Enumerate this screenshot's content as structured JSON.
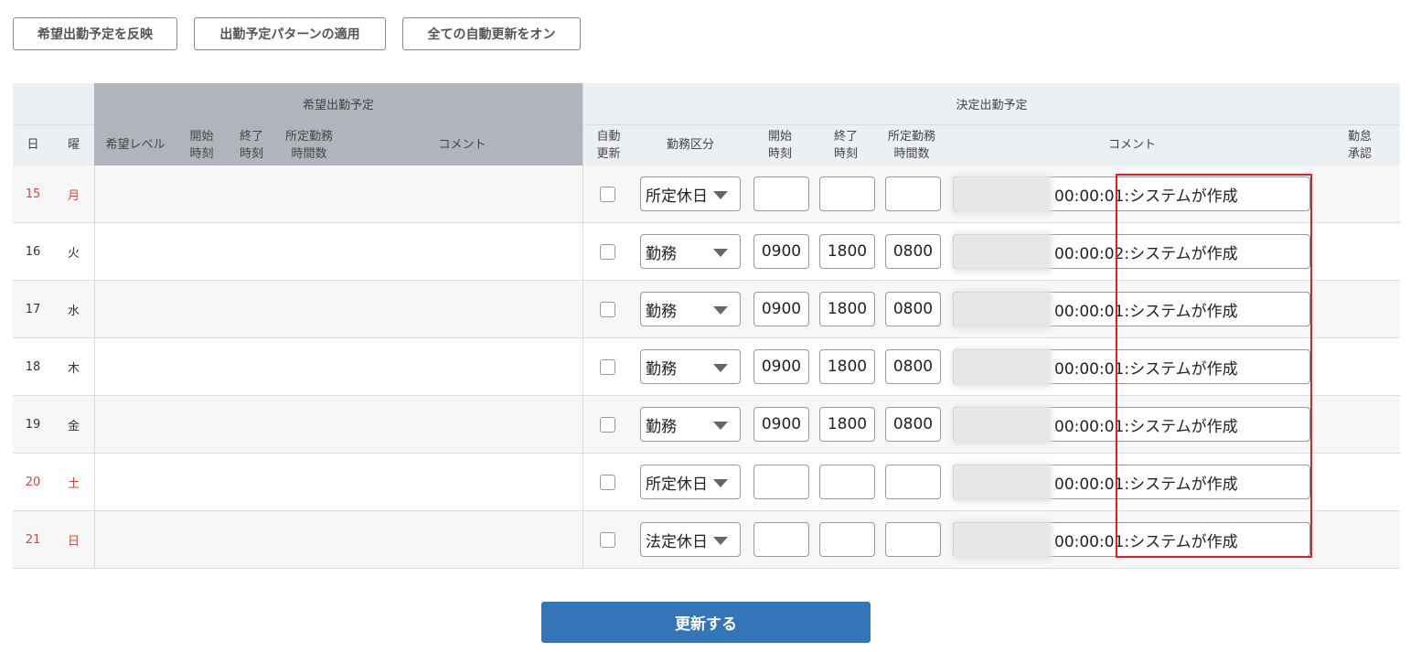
{
  "toolbar": {
    "reflect_label": "希望出勤予定を反映",
    "apply_pattern_label": "出勤予定パターンの適用",
    "auto_update_all_label": "全ての自動更新をオン"
  },
  "table": {
    "group_requested": "希望出勤予定",
    "group_decided": "決定出勤予定",
    "col_day": "日",
    "col_weekday": "曜",
    "col_req_level": "希望レベル",
    "col_req_start": "開始\n時刻",
    "col_req_end": "終了\n時刻",
    "col_req_hours": "所定勤務\n時間数",
    "col_req_comment": "コメント",
    "col_auto": "自動\n更新",
    "col_type": "勤務区分",
    "col_start": "開始\n時刻",
    "col_end": "終了\n時刻",
    "col_hours": "所定勤務\n時間数",
    "col_comment": "コメント",
    "col_approval": "勤怠\n承認"
  },
  "rows": [
    {
      "day": "15",
      "weekday": "月",
      "type": "所定休日",
      "start": "",
      "end": "",
      "hours": "",
      "comment": "00:00:01:システムが作成",
      "holiday": true
    },
    {
      "day": "16",
      "weekday": "火",
      "type": "勤務",
      "start": "0900",
      "end": "1800",
      "hours": "0800",
      "comment": "00:00:02:システムが作成",
      "holiday": false
    },
    {
      "day": "17",
      "weekday": "水",
      "type": "勤務",
      "start": "0900",
      "end": "1800",
      "hours": "0800",
      "comment": "00:00:01:システムが作成",
      "holiday": false
    },
    {
      "day": "18",
      "weekday": "木",
      "type": "勤務",
      "start": "0900",
      "end": "1800",
      "hours": "0800",
      "comment": "00:00:01:システムが作成",
      "holiday": false
    },
    {
      "day": "19",
      "weekday": "金",
      "type": "勤務",
      "start": "0900",
      "end": "1800",
      "hours": "0800",
      "comment": "00:00:01:システムが作成",
      "holiday": false
    },
    {
      "day": "20",
      "weekday": "土",
      "type": "所定休日",
      "start": "",
      "end": "",
      "hours": "",
      "comment": "00:00:01:システムが作成",
      "holiday": true
    },
    {
      "day": "21",
      "weekday": "日",
      "type": "法定休日",
      "start": "",
      "end": "",
      "hours": "",
      "comment": "00:00:01:システムが作成",
      "holiday": true
    }
  ],
  "submit_label": "更新する",
  "colors": {
    "header_gray": "#b1b5bb",
    "header_light": "#eceff4",
    "holiday_red": "#e0443a",
    "submit_blue": "#3375b7",
    "highlight_red": "#e02020"
  }
}
